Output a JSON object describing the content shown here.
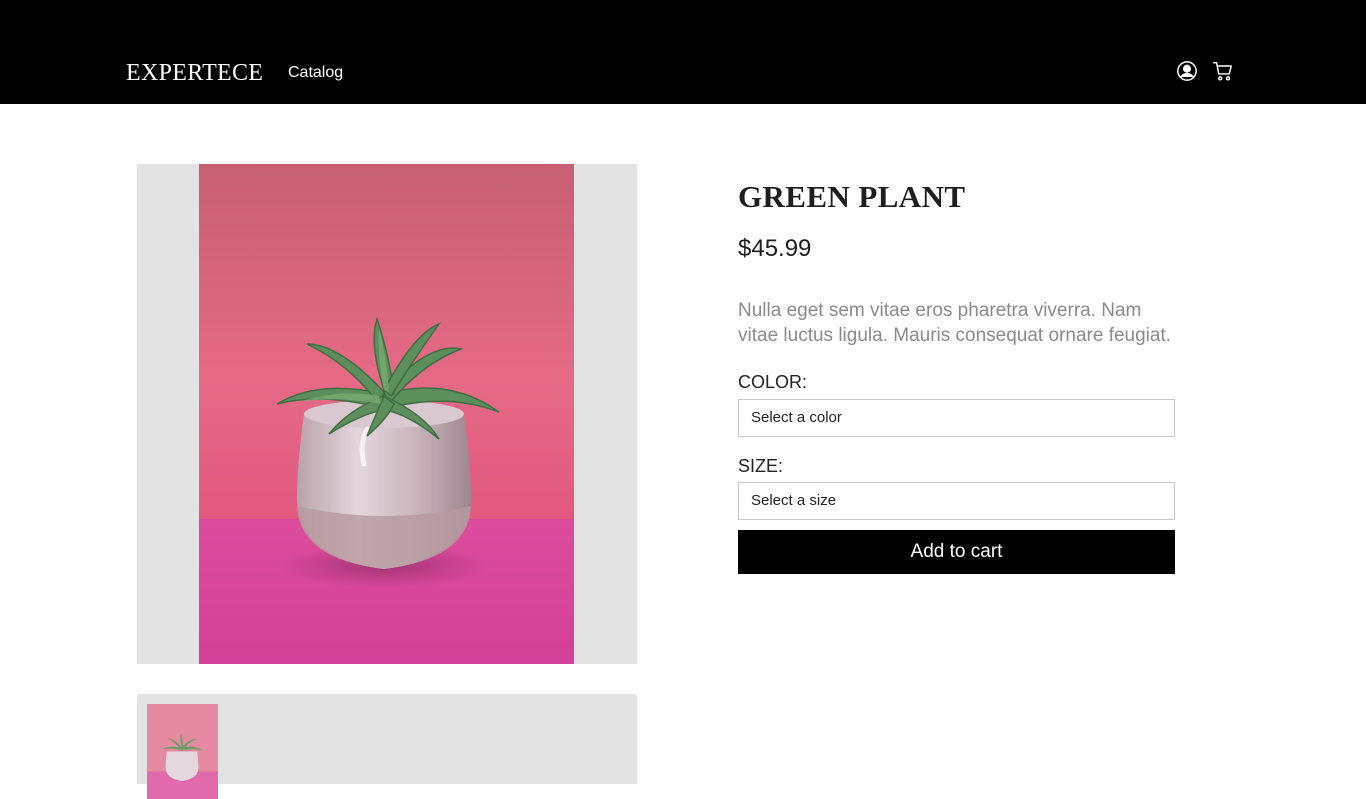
{
  "header": {
    "logo": "EXPERTECE",
    "nav": [
      {
        "label": "Catalog"
      }
    ],
    "icons": [
      "user-circle-icon",
      "cart-icon"
    ]
  },
  "gallery": {
    "main_image": "potted-succulent-photo",
    "thumbnails": [
      "potted-succulent-photo"
    ]
  },
  "product": {
    "title": "GREEN PLANT",
    "price": "$45.99",
    "description": "Nulla eget sem vitae eros pharetra viverra. Nam vitae luctus ligula. Mauris consequat ornare feugiat.",
    "color": {
      "label": "COLOR:",
      "selected": "Select a color"
    },
    "size": {
      "label": "SIZE:",
      "selected": "Select a size"
    },
    "add_to_cart_label": "Add to cart"
  },
  "colors": {
    "header_bg": "#000000",
    "gallery_bg": "#e3e3e3",
    "button_bg": "#000000",
    "photo_wall": "#e06b84",
    "photo_floor": "#d9489b"
  }
}
